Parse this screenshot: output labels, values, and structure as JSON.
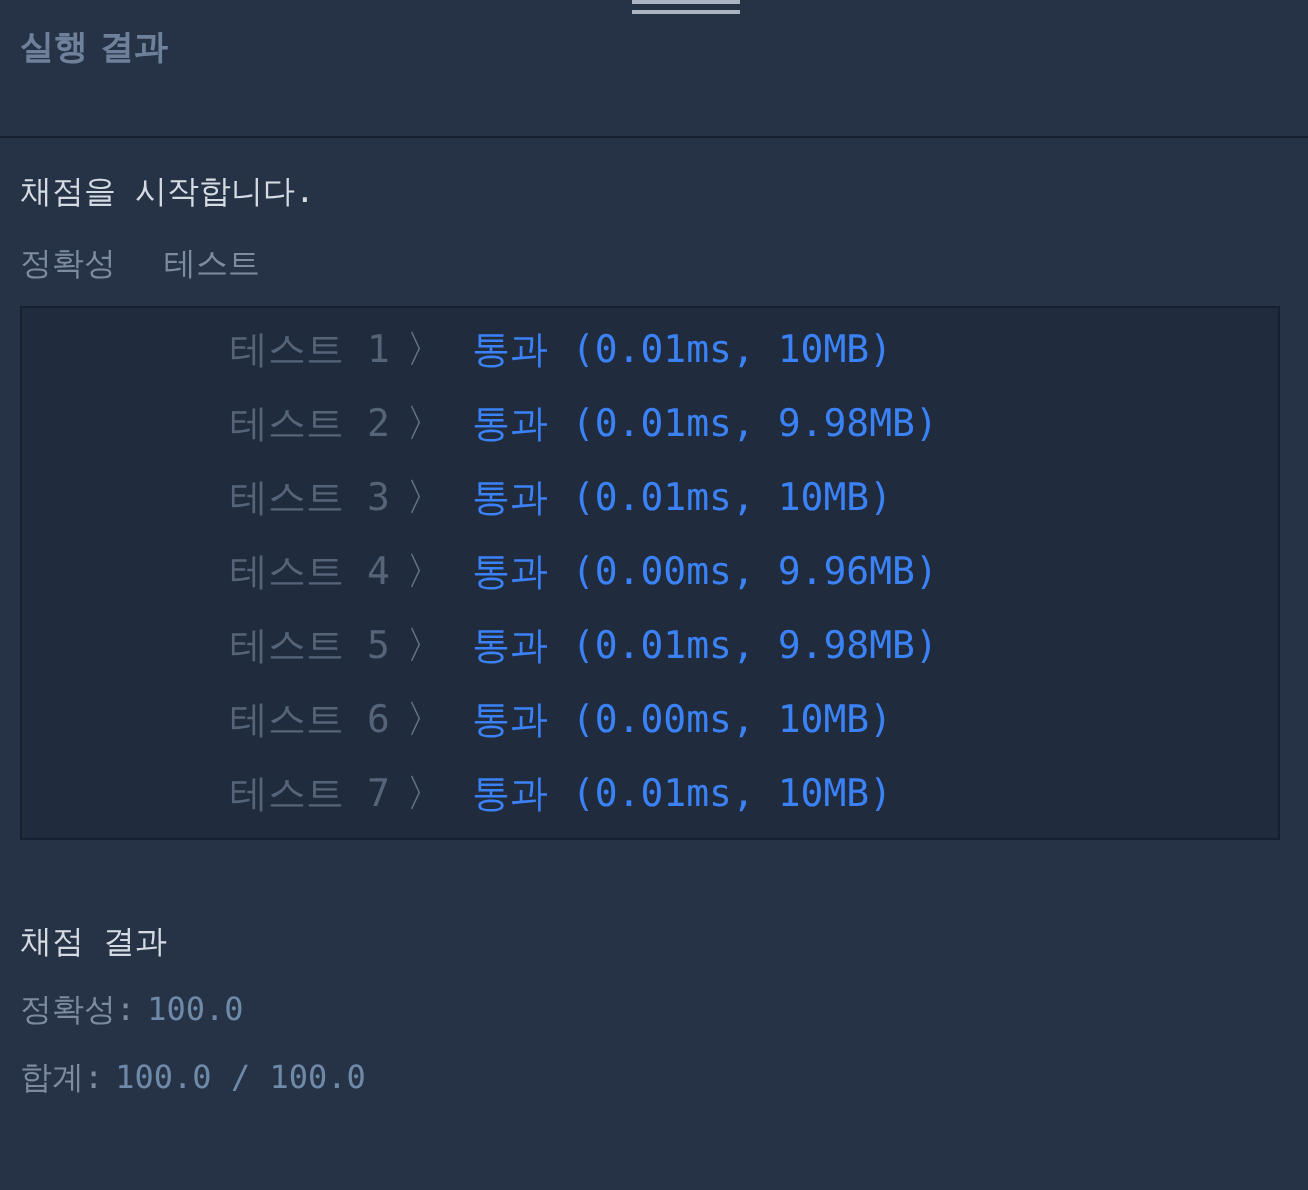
{
  "panel": {
    "title": "실행 결과"
  },
  "output": {
    "start_message": "채점을 시작합니다.",
    "section_labels": [
      "정확성",
      "테스트"
    ],
    "tests": [
      {
        "label": "테스트 1",
        "separator": "〉",
        "status": "통과",
        "detail": "(0.01ms, 10MB)"
      },
      {
        "label": "테스트 2",
        "separator": "〉",
        "status": "통과",
        "detail": "(0.01ms, 9.98MB)"
      },
      {
        "label": "테스트 3",
        "separator": "〉",
        "status": "통과",
        "detail": "(0.01ms, 10MB)"
      },
      {
        "label": "테스트 4",
        "separator": "〉",
        "status": "통과",
        "detail": "(0.00ms, 9.96MB)"
      },
      {
        "label": "테스트 5",
        "separator": "〉",
        "status": "통과",
        "detail": "(0.01ms, 9.98MB)"
      },
      {
        "label": "테스트 6",
        "separator": "〉",
        "status": "통과",
        "detail": "(0.00ms, 10MB)"
      },
      {
        "label": "테스트 7",
        "separator": "〉",
        "status": "통과",
        "detail": "(0.01ms, 10MB)"
      }
    ],
    "result_title": "채점 결과",
    "scores": [
      {
        "label": "정확성:",
        "value": "100.0"
      },
      {
        "label": "합계:",
        "value": "100.0 / 100.0"
      }
    ]
  }
}
